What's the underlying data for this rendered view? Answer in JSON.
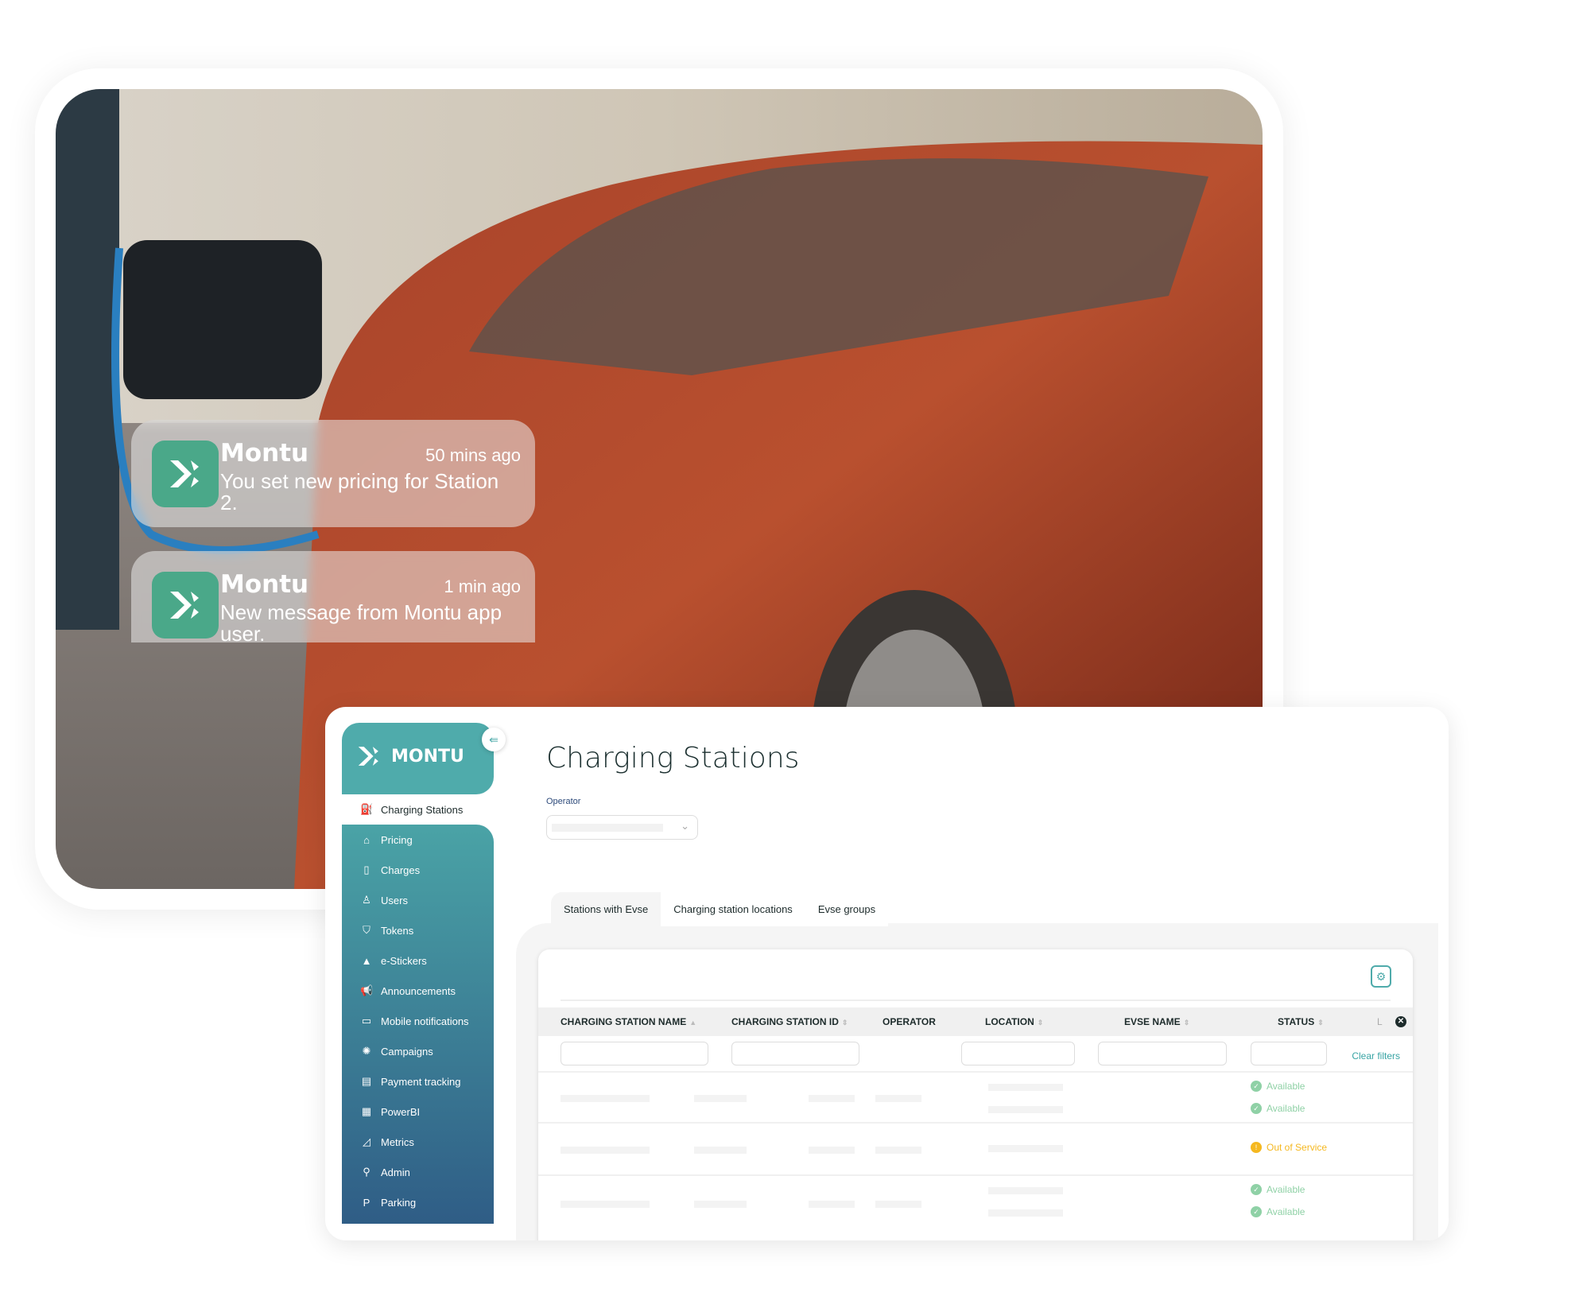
{
  "notifications": [
    {
      "app": "Montu",
      "time": "50 mins ago",
      "message": "You set new pricing for Station 2."
    },
    {
      "app": "Montu",
      "time": "1 min ago",
      "message": "New message from Montu app user."
    }
  ],
  "sidebar": {
    "brand": "MONTU",
    "active": {
      "label": "Charging Stations",
      "icon": "charging-station-icon"
    },
    "items": [
      {
        "label": "Pricing",
        "icon": "tag-icon"
      },
      {
        "label": "Charges",
        "icon": "battery-charge-icon"
      },
      {
        "label": "Users",
        "icon": "user-icon"
      },
      {
        "label": "Tokens",
        "icon": "shield-icon"
      },
      {
        "label": "e-Stickers",
        "icon": "sticker-icon"
      },
      {
        "label": "Announcements",
        "icon": "megaphone-icon"
      },
      {
        "label": "Mobile notifications",
        "icon": "message-icon"
      },
      {
        "label": "Campaigns",
        "icon": "campaign-icon"
      },
      {
        "label": "Payment tracking",
        "icon": "payment-icon"
      },
      {
        "label": "PowerBI",
        "icon": "chart-icon"
      },
      {
        "label": "Metrics",
        "icon": "metrics-icon"
      },
      {
        "label": "Admin",
        "icon": "admin-icon"
      },
      {
        "label": "Parking",
        "icon": "parking-icon"
      }
    ]
  },
  "main": {
    "title": "Charging Stations",
    "operator_label": "Operator",
    "tabs": [
      "Stations with Evse",
      "Charging station locations",
      "Evse groups"
    ],
    "columns": [
      "CHARGING STATION NAME",
      "CHARGING STATION ID",
      "OPERATOR",
      "LOCATION",
      "EVSE NAME",
      "STATUS",
      "L"
    ],
    "clear_filters": "Clear filters",
    "rows": [
      {
        "statuses": [
          "Available",
          "Available"
        ]
      },
      {
        "statuses": [
          "Out of Service"
        ]
      },
      {
        "statuses": [
          "Available",
          "Available"
        ]
      }
    ]
  },
  "colors": {
    "brand": "#4fabab",
    "available": "#8fd1a6",
    "out_of_service": "#f5b820"
  }
}
